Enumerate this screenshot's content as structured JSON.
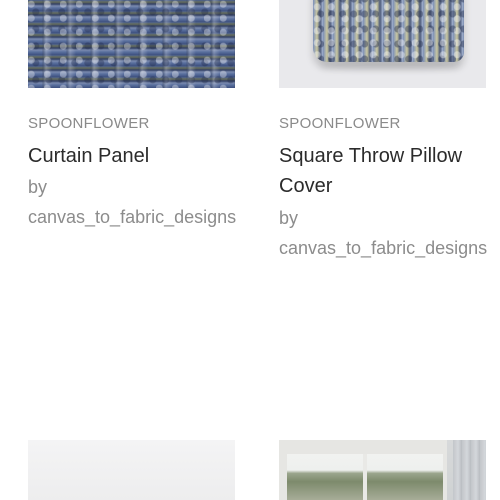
{
  "products": [
    {
      "brand": "SPOONFLOWER",
      "title": "Curtain Panel",
      "by": "by",
      "designer": "canvas_to_fabric_designs",
      "image_icon": "curtain-image"
    },
    {
      "brand": "SPOONFLOWER",
      "title_line1": "Square Throw Pillow",
      "title_line2": "Cover",
      "by": "by",
      "designer": "canvas_to_fabric_designs",
      "image_icon": "pillow-image"
    }
  ],
  "next_row": [
    {
      "image_icon": "product-image"
    },
    {
      "image_icon": "window-curtain-image"
    }
  ],
  "colors": {
    "brand_text": "#8a8a8a",
    "title_text": "#2b2b2b",
    "designer_text": "#8c8c8c"
  }
}
